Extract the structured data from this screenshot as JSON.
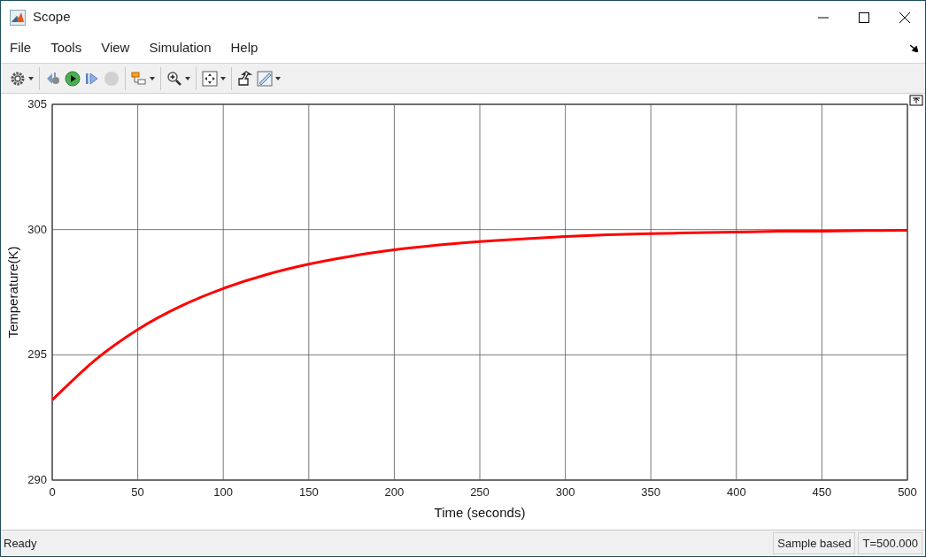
{
  "window": {
    "title": "Scope"
  },
  "menu": [
    "File",
    "Tools",
    "View",
    "Simulation",
    "Help"
  ],
  "toolbar": [
    [
      {
        "dropdown": true,
        "disabled": false
      }
    ],
    [
      {
        "dropdown": false,
        "disabled": false
      },
      {
        "dropdown": false,
        "disabled": false
      },
      {
        "dropdown": false,
        "disabled": false
      },
      {
        "dropdown": false,
        "disabled": true
      }
    ],
    [
      {
        "dropdown": true,
        "disabled": false
      }
    ],
    [
      {
        "dropdown": true,
        "disabled": false
      }
    ],
    [
      {
        "dropdown": true,
        "disabled": false
      }
    ],
    [
      {
        "dropdown": false,
        "disabled": false
      },
      {
        "dropdown": true,
        "disabled": false
      }
    ]
  ],
  "plot": {
    "chart_data": {
      "type": "line",
      "xlabel": "Time (seconds)",
      "ylabel": "Temperature(K)",
      "x": [
        0,
        25,
        50,
        75,
        100,
        125,
        150,
        175,
        200,
        225,
        250,
        275,
        300,
        325,
        350,
        375,
        400,
        425,
        450,
        475,
        500
      ],
      "grid": true,
      "series": [
        {
          "color": "#ff0000",
          "values": [
            293.2,
            294.79,
            296.01,
            296.94,
            297.65,
            298.2,
            298.62,
            298.94,
            299.19,
            299.38,
            299.52,
            299.63,
            299.72,
            299.79,
            299.84,
            299.87,
            299.9,
            299.93,
            299.94,
            299.96,
            299.97
          ]
        }
      ],
      "xlim": [
        0,
        500
      ],
      "ylim": [
        290,
        305
      ],
      "xticks": [
        0,
        50,
        100,
        150,
        200,
        250,
        300,
        350,
        400,
        450,
        500
      ],
      "yticks": [
        290,
        295,
        300,
        305
      ]
    }
  },
  "status_bar": {
    "message": "Ready",
    "mode": "Sample based",
    "time": "T=500.000"
  }
}
